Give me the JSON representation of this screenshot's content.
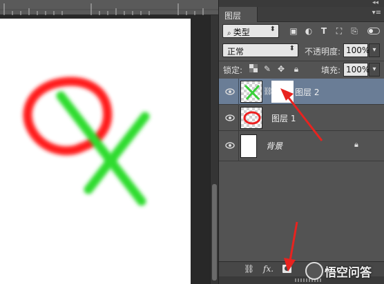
{
  "canvas": {
    "ruler_labels": [
      "",
      "",
      ""
    ],
    "colors": {
      "red_stroke": "#ff1a1a",
      "green_stroke": "#2fdc2f",
      "canvas_bg": "#ffffff"
    }
  },
  "panel": {
    "tab_label": "图层",
    "filter": {
      "label": "类型",
      "icon": "search-icon"
    },
    "filter_icons": [
      "image-icon",
      "adjustment-icon",
      "type-icon",
      "transform-icon",
      "smart-object-icon"
    ],
    "blend_mode": "正常",
    "opacity_label": "不透明度:",
    "opacity_value": "100%",
    "lock_label": "锁定:",
    "lock_icons": [
      "lock-transparency-icon",
      "lock-brush-icon",
      "lock-move-icon",
      "lock-all-icon"
    ],
    "fill_label": "填充:",
    "fill_value": "100%",
    "layers": [
      {
        "name": "图层 2",
        "selected": true,
        "has_mask": true,
        "italic": false
      },
      {
        "name": "图层 1",
        "selected": false,
        "has_mask": false,
        "italic": false
      },
      {
        "name": "背景",
        "selected": false,
        "has_mask": false,
        "italic": true,
        "locked": true
      }
    ],
    "bottom_icons": [
      "link-icon",
      "fx-icon",
      "mask-icon"
    ],
    "fx_label": "fx."
  },
  "watermark": {
    "text": "悟空问答"
  },
  "accent": {
    "selection": "#6a7d96",
    "arrow": "#e8231f"
  }
}
